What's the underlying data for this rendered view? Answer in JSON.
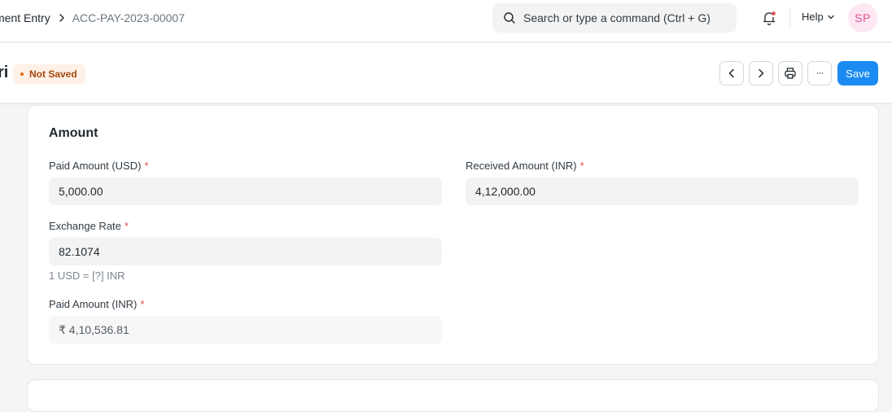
{
  "navbar": {
    "breadcrumb": [
      "ment Entry",
      "ACC-PAY-2023-00007"
    ],
    "search_placeholder": "Search or type a command (Ctrl + G)",
    "help_label": "Help",
    "avatar_initials": "SP"
  },
  "page_head": {
    "title": "ri",
    "status": "Not Saved",
    "save_label": "Save",
    "more_label": "···"
  },
  "amount_section": {
    "title": "Amount",
    "paid_amount_usd": {
      "label": "Paid Amount (USD)",
      "required": "*",
      "value": "5,000.00"
    },
    "received_amount_inr": {
      "label": "Received Amount (INR)",
      "required": "*",
      "value": "4,12,000.00"
    },
    "exchange_rate": {
      "label": "Exchange Rate",
      "required": "*",
      "value": "82.1074",
      "description": "1 USD = [?] INR"
    },
    "paid_amount_inr": {
      "label": "Paid Amount (INR)",
      "required": "*",
      "value": "₹ 4,10,536.81"
    }
  },
  "colors": {
    "primary": "#1b8bf2",
    "status_bg": "#fff1e7",
    "status_text": "#a5480e",
    "avatar_bg": "#fce7f3",
    "avatar_text": "#e14e8f",
    "required": "#e24c4c"
  }
}
